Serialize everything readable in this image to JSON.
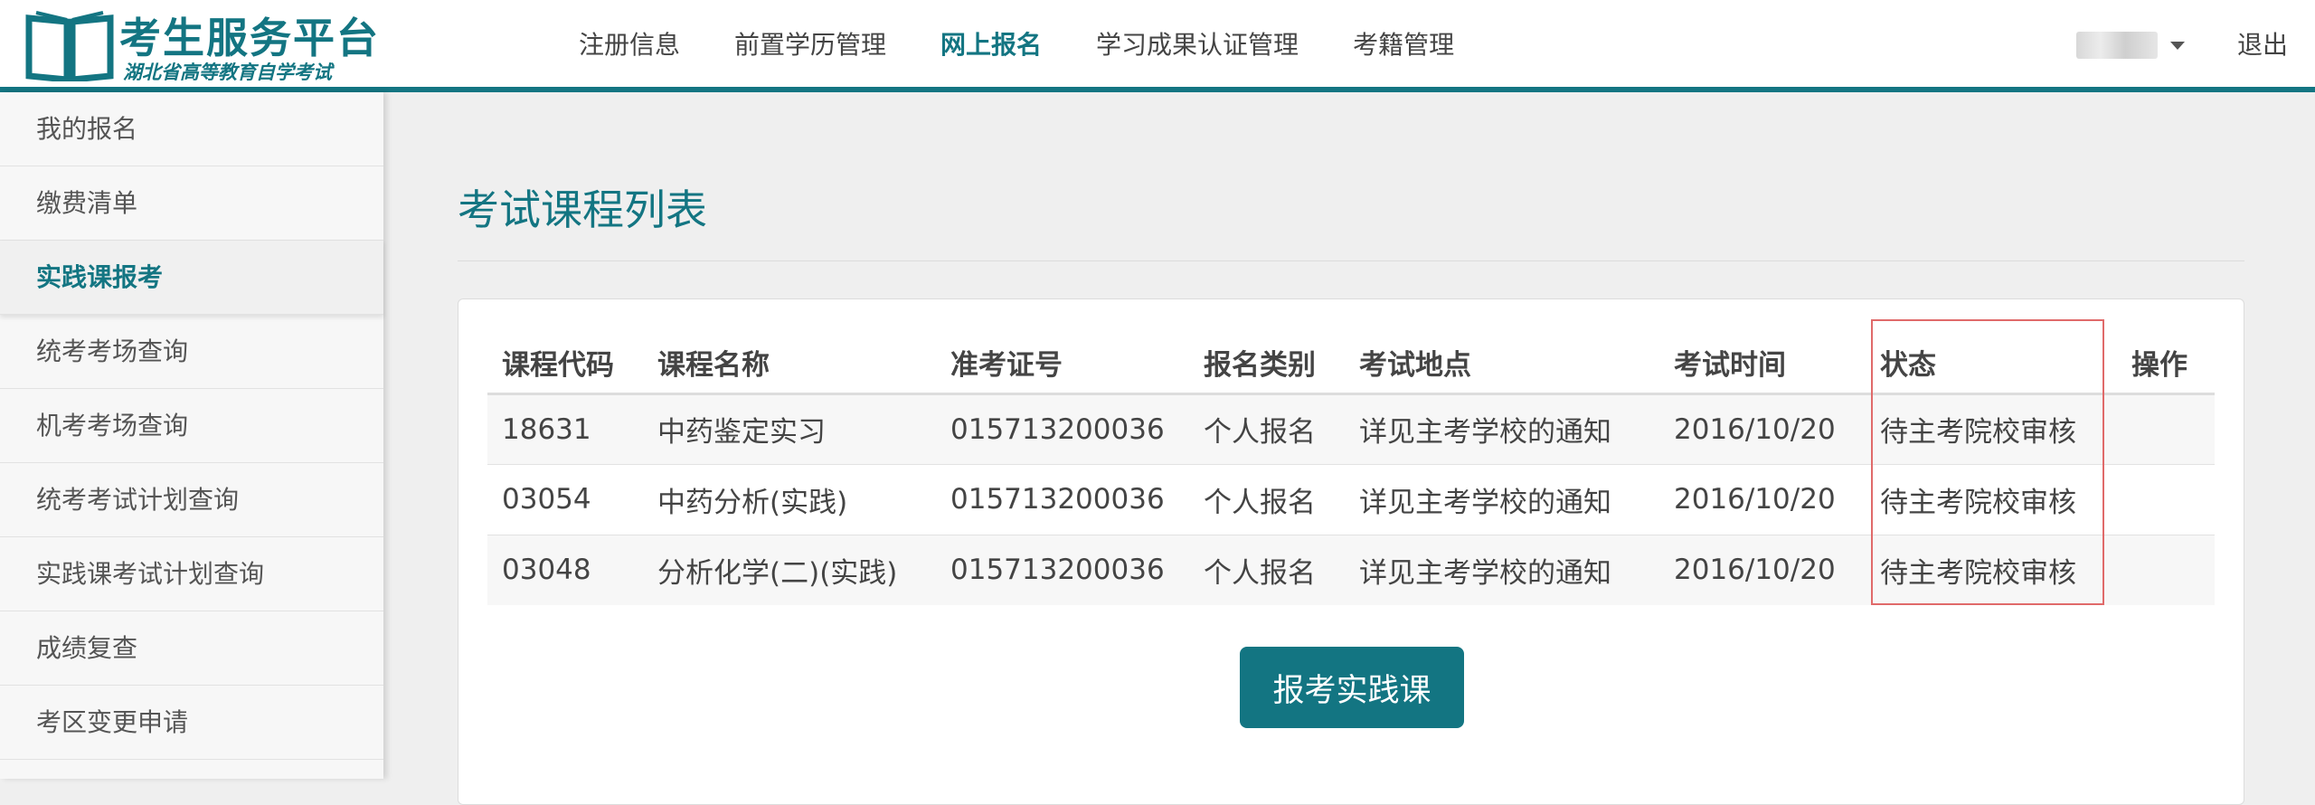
{
  "header": {
    "logo_title": "考生服务平台",
    "logo_subtitle": "湖北省高等教育自学考试",
    "nav": [
      {
        "label": "注册信息",
        "active": false
      },
      {
        "label": "前置学历管理",
        "active": false
      },
      {
        "label": "网上报名",
        "active": true
      },
      {
        "label": "学习成果认证管理",
        "active": false
      },
      {
        "label": "考籍管理",
        "active": false
      }
    ],
    "logout_label": "退出"
  },
  "sidebar": {
    "items": [
      {
        "label": "我的报名",
        "active": false
      },
      {
        "label": "缴费清单",
        "active": false
      },
      {
        "label": "实践课报考",
        "active": true
      },
      {
        "label": "统考考场查询",
        "active": false
      },
      {
        "label": "机考考场查询",
        "active": false
      },
      {
        "label": "统考考试计划查询",
        "active": false
      },
      {
        "label": "实践课考试计划查询",
        "active": false
      },
      {
        "label": "成绩复查",
        "active": false
      },
      {
        "label": "考区变更申请",
        "active": false
      }
    ]
  },
  "main": {
    "title": "考试课程列表",
    "table": {
      "columns": [
        "课程代码",
        "课程名称",
        "准考证号",
        "报名类别",
        "考试地点",
        "考试时间",
        "状态",
        "操作"
      ],
      "rows": [
        [
          "18631",
          "中药鉴定实习",
          "015713200036",
          "个人报名",
          "详见主考学校的通知",
          "2016/10/20",
          "待主考院校审核",
          ""
        ],
        [
          "03054",
          "中药分析(实践)",
          "015713200036",
          "个人报名",
          "详见主考学校的通知",
          "2016/10/20",
          "待主考院校审核",
          ""
        ],
        [
          "03048",
          "分析化学(二)(实践)",
          "015713200036",
          "个人报名",
          "详见主考学校的通知",
          "2016/10/20",
          "待主考院校审核",
          ""
        ]
      ]
    },
    "button_label": "报考实践课"
  },
  "colors": {
    "brand": "#137582",
    "highlight_box": "#e06a6a"
  }
}
